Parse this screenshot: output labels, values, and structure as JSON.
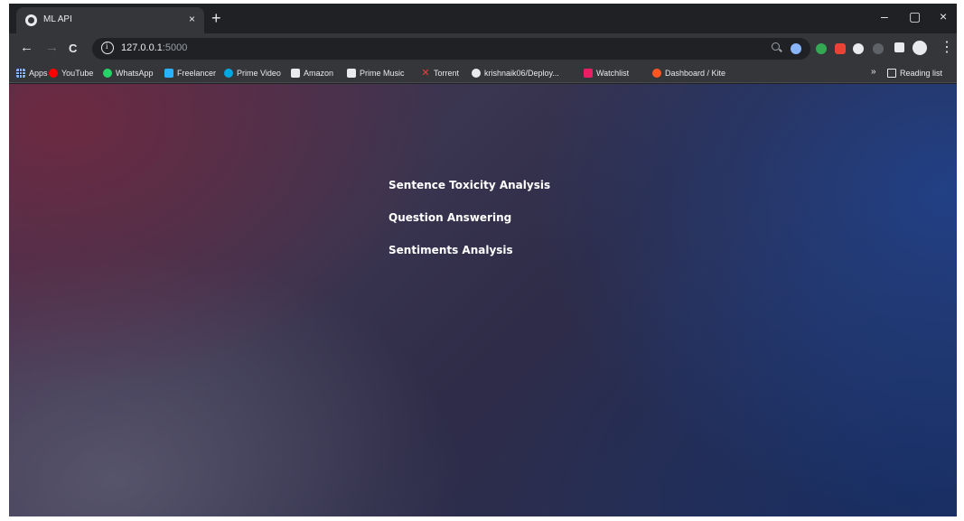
{
  "tab": {
    "title": "ML API",
    "close": "×",
    "new_tab": "+"
  },
  "window_controls": {
    "minimize": "–",
    "maximize": "▢",
    "close": "×"
  },
  "toolbar": {
    "back": "←",
    "forward": "→",
    "reload": "C",
    "url_host": "127.0.0.1",
    "url_port": ":5000",
    "menu": "⋮"
  },
  "bookmarks": [
    {
      "label": "Apps",
      "icon": "apps-grid-icon",
      "color": "#8ab4f8"
    },
    {
      "label": "YouTube",
      "icon": "youtube-icon",
      "color": "#ff0000"
    },
    {
      "label": "WhatsApp",
      "icon": "whatsapp-icon",
      "color": "#25d366"
    },
    {
      "label": "Freelancer",
      "icon": "freelancer-icon",
      "color": "#29b2fe"
    },
    {
      "label": "Prime Video",
      "icon": "prime-video-icon",
      "color": "#00a8e1"
    },
    {
      "label": "Amazon",
      "icon": "amazon-icon",
      "color": "#e8eaed"
    },
    {
      "label": "Prime Music",
      "icon": "prime-music-icon",
      "color": "#e8eaed"
    },
    {
      "label": "Torrent",
      "icon": "torrent-icon",
      "color": "#ea4335"
    },
    {
      "label": "krishnaik06/Deploy...",
      "icon": "github-icon",
      "color": "#e8eaed"
    },
    {
      "label": "Watchlist",
      "icon": "watchlist-icon",
      "color": "#e91e63"
    },
    {
      "label": "Dashboard / Kite",
      "icon": "kite-icon",
      "color": "#ff5722"
    }
  ],
  "bookmarks_more": "»",
  "reading_list": {
    "label": "Reading list",
    "icon": "reading-list-icon"
  },
  "page": {
    "links": [
      "Sentence Toxicity Analysis",
      "Question Answering",
      "Sentiments Analysis"
    ]
  },
  "extensions": [
    {
      "icon": "extension-blue-icon",
      "color": "#8ab4f8"
    },
    {
      "icon": "extension-green-icon",
      "color": "#34a853"
    },
    {
      "icon": "extension-red-icon",
      "color": "#ea4335"
    },
    {
      "icon": "extension-white-icon",
      "color": "#e8eaed"
    },
    {
      "icon": "extension-dark-icon",
      "color": "#5f6368"
    }
  ]
}
